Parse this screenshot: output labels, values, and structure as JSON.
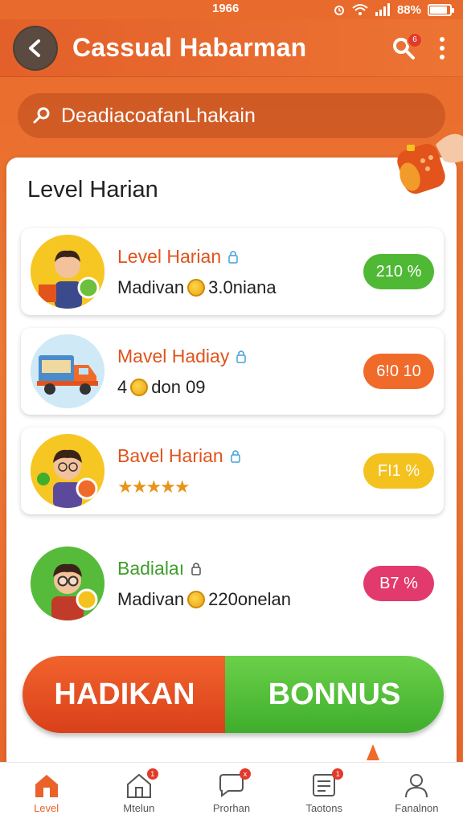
{
  "status_bar": {
    "time": "1966",
    "battery": "88%",
    "battery_level": 0.88
  },
  "header": {
    "title": "Cassual Habarman",
    "notif_count": "6"
  },
  "search": {
    "placeholder": "DeadiacoafanLhakain"
  },
  "section": {
    "title": "Level Harian"
  },
  "levels": [
    {
      "title": "Level Harian",
      "title_color": "#e0531c",
      "sub_label": "Madivan",
      "sub_value": "3.0niana",
      "badge": "210 %",
      "badge_color": "#4fb834",
      "avatar": "person-with-shop"
    },
    {
      "title": "Mavel Hadiay",
      "title_color": "#e0531c",
      "sub_label": "4",
      "sub_value": "don 09",
      "badge": "6!0 10",
      "badge_color": "#f06a2a",
      "avatar": "delivery-truck"
    },
    {
      "title": "Bavel Harian",
      "title_color": "#e0531c",
      "stars": "★★★★★",
      "badge": "FI1 %",
      "badge_color": "#f4c21e",
      "avatar": "person-with-ball"
    },
    {
      "title": "Badialaı",
      "title_color": "#3f9e2a",
      "sub_label": "Madivan",
      "sub_value": "220onelan",
      "badge": "B7 %",
      "badge_color": "#e23a6c",
      "avatar": "person-with-glasses"
    }
  ],
  "bonus": {
    "left_label": "HADIKAN",
    "right_label": "BONNUS"
  },
  "nav": [
    {
      "label": "Level",
      "icon": "home-icon",
      "active": true
    },
    {
      "label": "Mtelun",
      "icon": "home-outline-icon",
      "badge": "1"
    },
    {
      "label": "Prorhan",
      "icon": "chat-icon",
      "badge": "x"
    },
    {
      "label": "Taotons",
      "icon": "list-icon",
      "badge": "1"
    },
    {
      "label": "Fanalnon",
      "icon": "profile-icon"
    }
  ]
}
